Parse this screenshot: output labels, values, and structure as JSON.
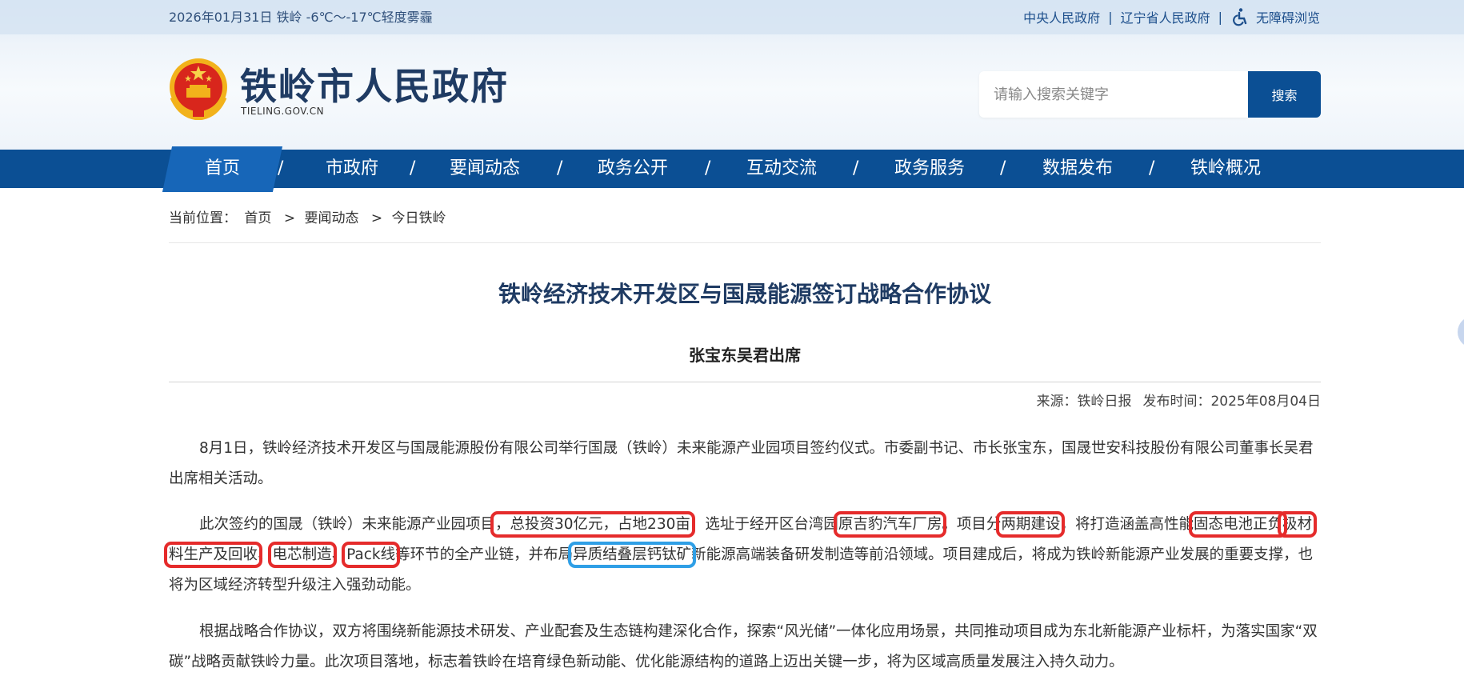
{
  "topbar": {
    "date_weather": "2026年01月31日  铁岭  -6℃～-17℃轻度雾霾",
    "links": [
      "中央人民政府",
      "辽宁省人民政府"
    ],
    "accessibility": "无障碍浏览"
  },
  "header": {
    "site_title": "铁岭市人民政府",
    "site_domain": "TIELING.GOV.CN",
    "search_placeholder": "请输入搜索关键字",
    "search_button": "搜索"
  },
  "nav": {
    "items": [
      "首页",
      "市政府",
      "要闻动态",
      "政务公开",
      "互动交流",
      "政务服务",
      "数据发布",
      "铁岭概况"
    ],
    "separator": "/"
  },
  "breadcrumb": {
    "label": "当前位置：",
    "items": [
      "首页",
      "要闻动态",
      "今日铁岭"
    ],
    "separator": ">"
  },
  "article": {
    "title": "铁岭经济技术开发区与国晟能源签订战略合作协议",
    "subtitle": "张宝东吴君出席",
    "source": "来源：铁岭日报",
    "publish_time": "发布时间：2025年08月04日",
    "p1": "8月1日，铁岭经济技术开发区与国晟能源股份有限公司举行国晟（铁岭）未来能源产业园项目签约仪式。市委副书记、市长张宝东，国晟世安科技股份有限公司董事长吴君出席相关活动。",
    "p2": {
      "t1": "此次签约的国晟（铁岭）未来能源产业园项目",
      "h1": "，总投资30亿元，占地230亩",
      "t2": "，选址于经开区台湾园",
      "h2": "原吉豹汽车厂房",
      "t3": "。项目分",
      "h3": "两期建设",
      "t4": "，将打造涵盖高性能",
      "h4a": "固态电池正负",
      "h4b": "极材料生产及回收",
      "t5": "、",
      "h5": "电芯制造",
      "t6": "、",
      "h6": "Pack线",
      "t7": "等环节的全产业链，并布局",
      "h7": "异质结叠层钙钛矿",
      "t8": "新能源高端装备研发制造等前沿领域。项目建成后，将成为铁岭新能源产业发展的重要支撑，也将为区域经济转型升级注入强劲动能。"
    },
    "p3": "根据战略合作协议，双方将围绕新能源技术研发、产业配套及生态链构建深化合作，探索“风光储”一体化应用场景，共同推动项目成为东北新能源产业标杆，为落实国家“双碳”战略贡献铁岭力量。此次项目落地，标志着铁岭在培育绿色新动能、优化能源结构的道路上迈出关键一步，将为区域高质量发展注入持久动力。"
  },
  "colors": {
    "nav_bg": "#0b4f94",
    "nav_active": "#1766b8",
    "title": "#1f3b63",
    "highlight_red": "#e52b2b",
    "highlight_blue": "#2f9fe6"
  },
  "icons": [
    "national-emblem-icon",
    "accessibility-icon"
  ]
}
